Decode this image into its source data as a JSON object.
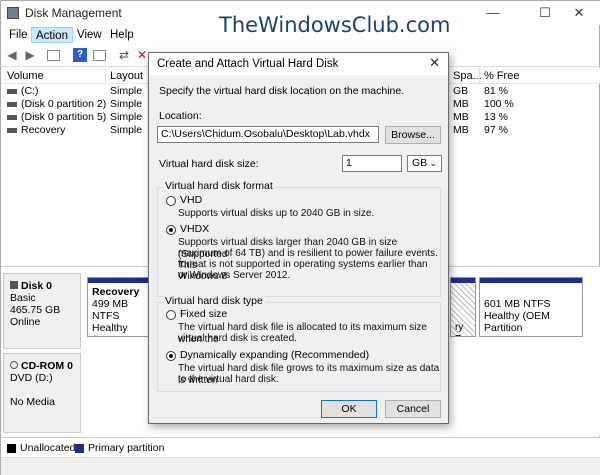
{
  "window": {
    "title": "Disk Management",
    "watermark": "TheWindowsClub.com",
    "minimize": "—",
    "maximize": "☐",
    "close": "✕"
  },
  "menu": [
    "File",
    "Action",
    "View",
    "Help"
  ],
  "volumes": {
    "headers": [
      "Volume",
      "Layout",
      "Spa...",
      "% Free"
    ],
    "rows": [
      {
        "volume": "(C:)",
        "layout": "Simple",
        "spa": "GB",
        "free": "81 %"
      },
      {
        "volume": "(Disk 0 partition 2)",
        "layout": "Simple",
        "spa": "MB",
        "free": "100 %"
      },
      {
        "volume": "(Disk 0 partition 5)",
        "layout": "Simple",
        "spa": "MB",
        "free": "13 %"
      },
      {
        "volume": "Recovery",
        "layout": "Simple",
        "spa": "MB",
        "free": "97 %"
      }
    ]
  },
  "disks": [
    {
      "name": "Disk 0",
      "type": "Basic",
      "size": "465.75 GB",
      "status": "Online"
    },
    {
      "name": "CD-ROM 0",
      "type": "DVD (D:)",
      "size": "",
      "status": "No Media"
    }
  ],
  "partitions": {
    "recovery": {
      "name": "Recovery",
      "size": "499 MB NTFS",
      "status": "Healthy (OEM"
    },
    "mid": {
      "text": "ry P"
    },
    "oem": {
      "size": "601 MB NTFS",
      "status": "Healthy (OEM Partition"
    }
  },
  "legend": {
    "unallocated": "Unallocated",
    "primary": "Primary partition"
  },
  "dialog": {
    "title": "Create and Attach Virtual Hard Disk",
    "close": "✕",
    "intro": "Specify the virtual hard disk location on the machine.",
    "location_label": "Location:",
    "location_value": "C:\\Users\\Chidum.Osobalu\\Desktop\\Lab.vhdx",
    "browse": "Browse...",
    "size_label": "Virtual hard disk size:",
    "size_value": "1",
    "size_unit": "GB",
    "format_group": "Virtual hard disk format",
    "vhd_label": "VHD",
    "vhd_desc": "Supports virtual disks up to 2040 GB in size.",
    "vhdx_label": "VHDX",
    "vhdx_desc1": "Supports virtual disks larger than 2040 GB in size (Supported",
    "vhdx_desc2": "maximum of 64 TB) and is resilient to power failure events. This",
    "vhdx_desc3": "format is not supported in operating systems earlier than Windows 8",
    "vhdx_desc4": "or Windows Server 2012.",
    "type_group": "Virtual hard disk type",
    "fixed_label": "Fixed size",
    "fixed_desc1": "The virtual hard disk file is allocated to its maximum size when the",
    "fixed_desc2": "virtual hard disk is created.",
    "dynamic_label": "Dynamically expanding (Recommended)",
    "dynamic_desc1": "The virtual hard disk file grows to its maximum size as data is written",
    "dynamic_desc2": "to the virtual hard disk.",
    "ok": "OK",
    "cancel": "Cancel"
  },
  "colors": {
    "primary_partition": "#1f2b8f",
    "accent": "#0078d7"
  }
}
